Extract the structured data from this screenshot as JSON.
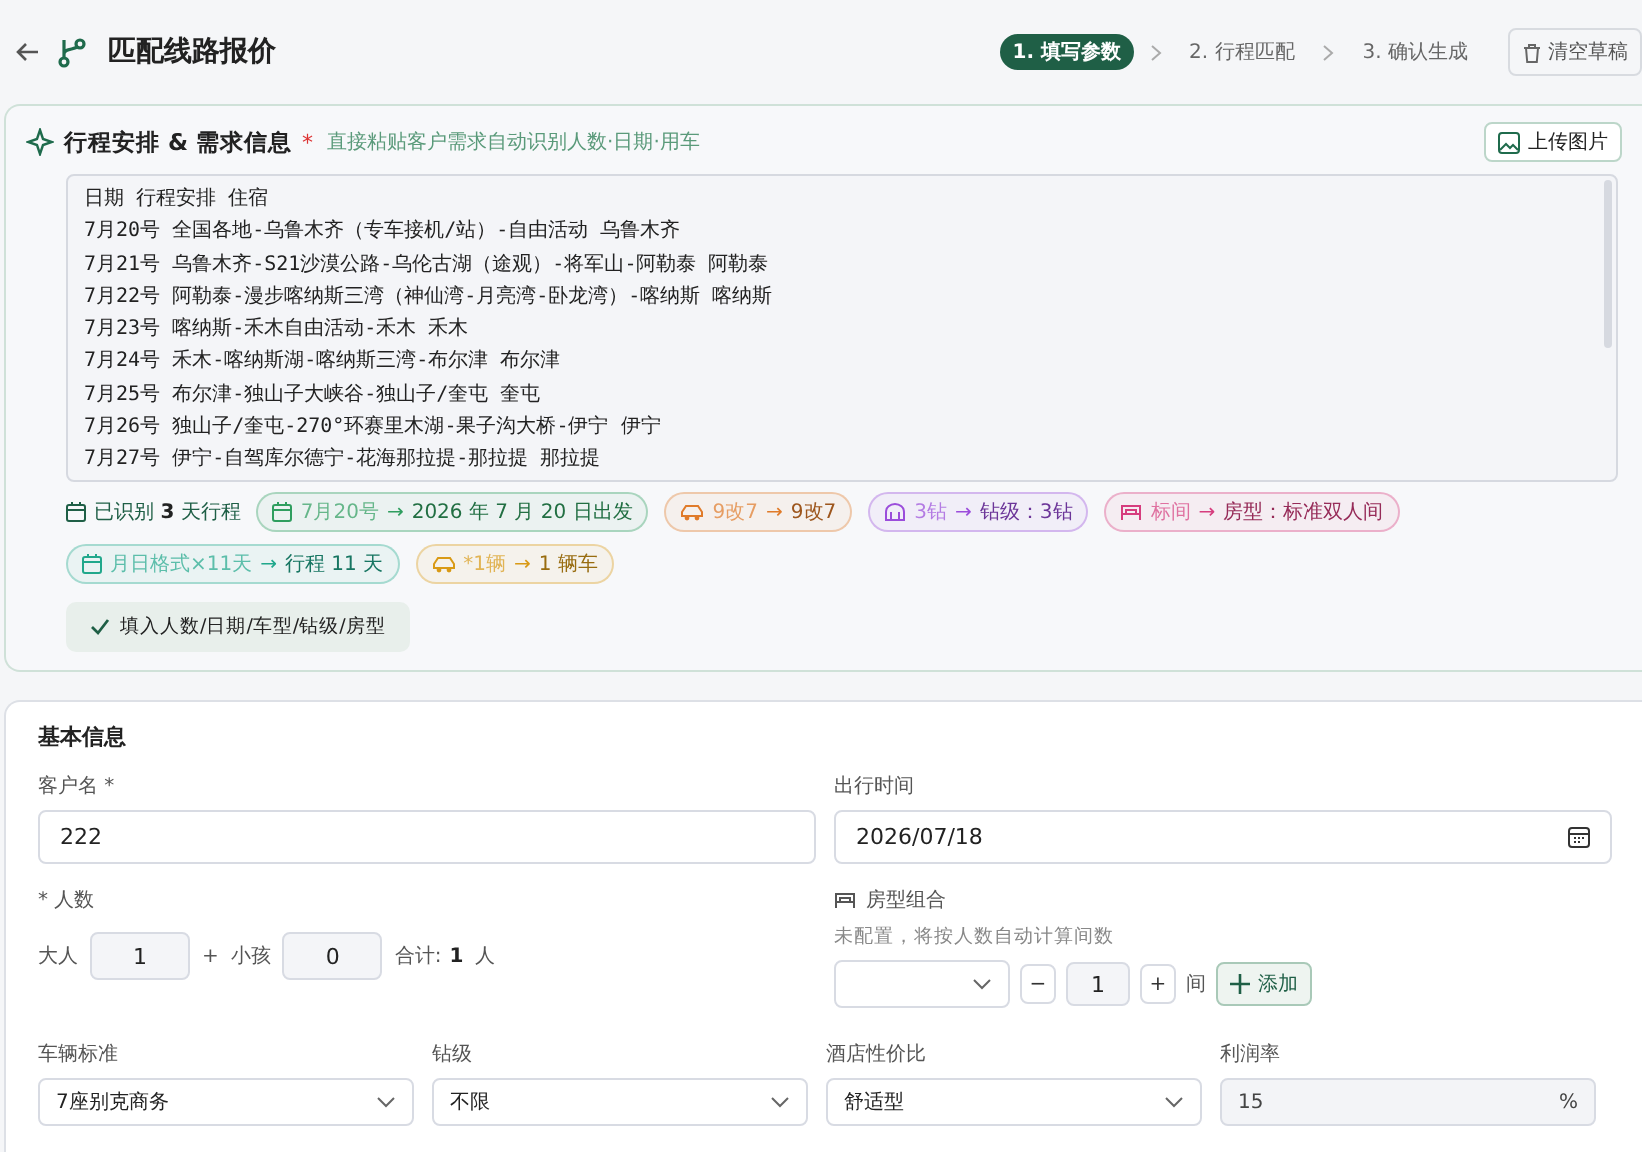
{
  "header": {
    "title": "匹配线路报价",
    "steps": [
      {
        "label": "1. 填写参数",
        "selected": true
      },
      {
        "label": "2. 行程匹配",
        "selected": false
      },
      {
        "label": "3. 确认生成",
        "selected": false
      }
    ],
    "clear_button": "清空草稿"
  },
  "itinerary": {
    "title": "行程安排 & 需求信息",
    "required_mark": "*",
    "hint": "直接粘贴客户需求自动识别人数·日期·用车",
    "upload_button": "上传图片",
    "lines": [
      "日期 行程安排 住宿",
      "7月20号 全国各地-乌鲁木齐（专车接机/站）-自由活动 乌鲁木齐",
      "7月21号 乌鲁木齐-S21沙漠公路-乌伦古湖（途观）-将军山-阿勒泰 阿勒泰",
      "7月22号 阿勒泰-漫步喀纳斯三湾（神仙湾-月亮湾-卧龙湾）-喀纳斯 喀纳斯",
      "7月23号 喀纳斯-禾木自由活动-禾木 禾木",
      "7月24号 禾木-喀纳斯湖-喀纳斯三湾-布尔津 布尔津",
      "7月25号 布尔津-独山子大峡谷-独山子/奎屯 奎屯",
      "7月26号 独山子/奎屯-270°环赛里木湖-果子沟大桥-伊宁 伊宁",
      "7月27号 伊宁-自驾库尔德宁-花海那拉提-那拉提 那拉提"
    ],
    "chips": [
      {
        "kind": "summary",
        "color": "#1f5f46",
        "text": "已识别 **3** 天行程"
      },
      {
        "kind": "calendar",
        "color": "#2f9e5f",
        "from": "7月20号",
        "arrow": "→",
        "to": "2026 年 7 月 20 日出发"
      },
      {
        "kind": "car",
        "color": "#e07b2a",
        "from": "9改7",
        "arrow": "→",
        "to": "9改7"
      },
      {
        "kind": "diamond",
        "color": "#9b4ddb",
        "from": "3钻",
        "arrow": "→",
        "to": "钻级：3钻"
      },
      {
        "kind": "bed",
        "color": "#d63d7e",
        "from": "标间",
        "arrow": "→",
        "to": "房型：标准双人间"
      },
      {
        "kind": "calendar",
        "color": "#21a88c",
        "from": "月日格式×11天",
        "arrow": "→",
        "to": "行程 11 天"
      },
      {
        "kind": "car",
        "color": "#d99a16",
        "from": "*1辆",
        "arrow": "→",
        "to": "1 辆车"
      }
    ],
    "apply_button": "填入人数/日期/车型/钻级/房型"
  },
  "basic": {
    "title": "基本信息",
    "customer_label": "客户名 *",
    "customer_value": "222",
    "date_label": "出行时间",
    "date_value": "2026/07/18",
    "people_label": "* 人数",
    "adult_label": "大人",
    "adult_value": "1",
    "plus": "+",
    "child_label": "小孩",
    "child_value": "0",
    "total_label": "合计:",
    "total_value": "1",
    "total_unit": "人",
    "room_label": "房型组合",
    "room_hint": "未配置，将按人数自动计算间数",
    "room_minus": "−",
    "room_count": "1",
    "room_plus": "+",
    "room_unit": "间",
    "add_button": "添加",
    "fields": [
      {
        "label": "车辆标准",
        "kind": "select",
        "value": "7座别克商务"
      },
      {
        "label": "钻级",
        "kind": "select",
        "value": "不限"
      },
      {
        "label": "酒店性价比",
        "kind": "select",
        "value": "舒适型"
      },
      {
        "label": "利润率",
        "kind": "percent",
        "value": "15",
        "unit": "%"
      }
    ]
  }
}
